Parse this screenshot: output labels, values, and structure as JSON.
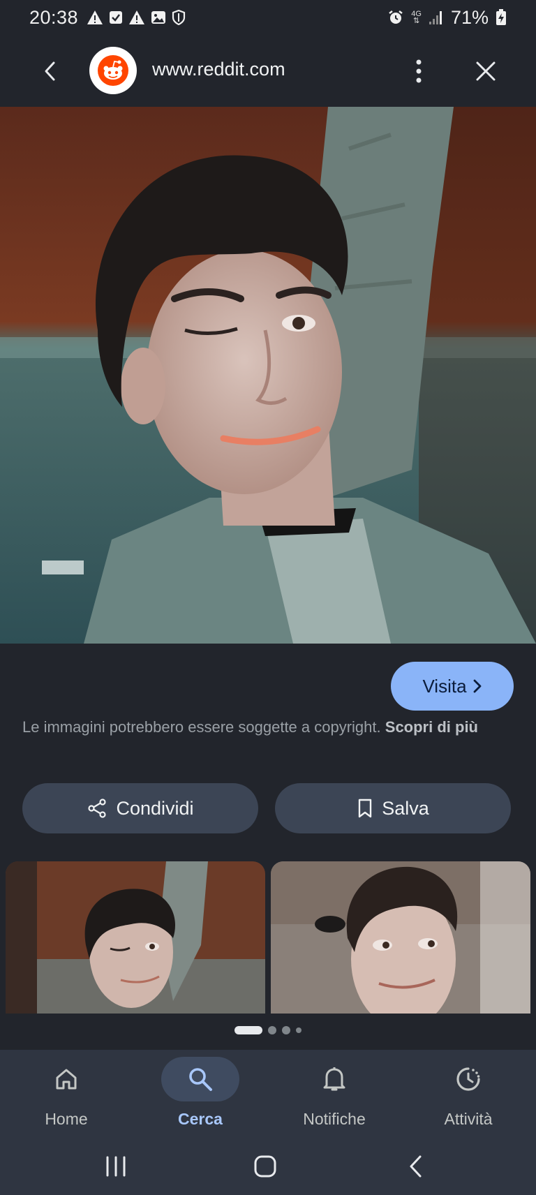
{
  "status_bar": {
    "time": "20:38",
    "network": "4G",
    "battery": "71%",
    "icons": [
      "warning-icon",
      "check-box-icon",
      "warning-icon",
      "image-icon",
      "shield-icon",
      "alarm-icon",
      "signal-icon",
      "battery-charging-icon"
    ]
  },
  "header": {
    "url": "www.reddit.com",
    "logo": "reddit-logo"
  },
  "main_image": {
    "alt": "image-result"
  },
  "visit": {
    "label": "Visita"
  },
  "copyright": {
    "text": "Le immagini potrebbero essere soggette a copyright.",
    "link": "Scopri di più"
  },
  "actions": {
    "share_label": "Condividi",
    "save_label": "Salva"
  },
  "carousel": {
    "page": 1,
    "pages": 4
  },
  "bottom_nav": {
    "items": [
      {
        "label": "Home",
        "icon": "home-icon"
      },
      {
        "label": "Cerca",
        "icon": "search-icon"
      },
      {
        "label": "Notifiche",
        "icon": "bell-icon"
      },
      {
        "label": "Attività",
        "icon": "activity-icon"
      }
    ],
    "active_index": 1
  },
  "colors": {
    "background": "#22252c",
    "accent": "#8ab4f8",
    "button": "#3c4555",
    "nav": "#2f3541",
    "reddit": "#ff4500"
  }
}
